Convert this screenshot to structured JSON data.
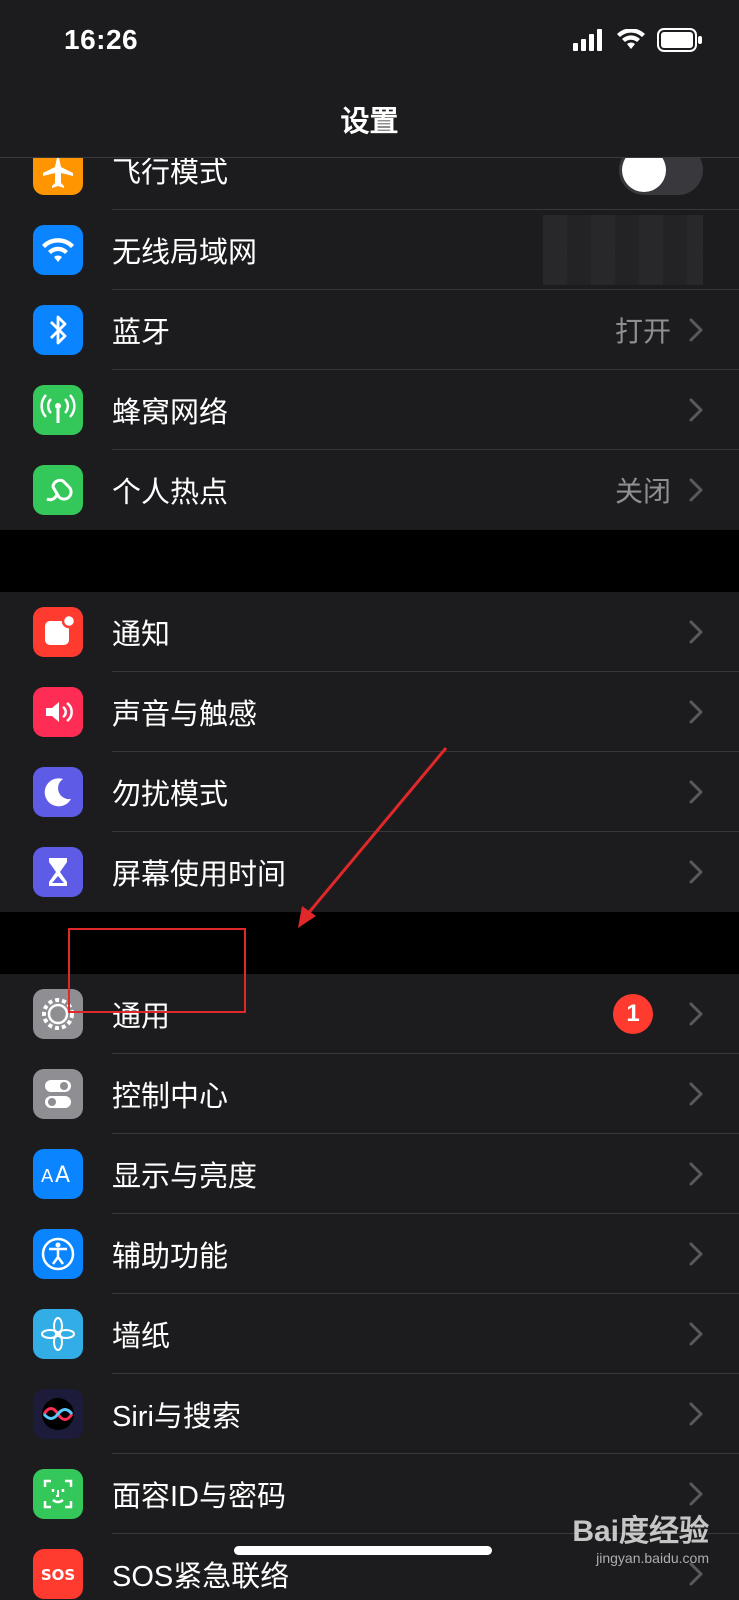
{
  "status_bar": {
    "time": "16:26"
  },
  "nav": {
    "title": "设置"
  },
  "groups": [
    [
      {
        "label": "飞行模式",
        "icon": "airplane-icon",
        "color": "#ff9500",
        "accessory": "toggle"
      },
      {
        "label": "无线局域网",
        "icon": "wifi-icon",
        "color": "#0a84ff",
        "accessory": "blurred"
      },
      {
        "label": "蓝牙",
        "icon": "bluetooth-icon",
        "color": "#0a84ff",
        "value": "打开"
      },
      {
        "label": "蜂窝网络",
        "icon": "antenna-icon",
        "color": "#34c759"
      },
      {
        "label": "个人热点",
        "icon": "hotspot-icon",
        "color": "#34c759",
        "value": "关闭"
      }
    ],
    [
      {
        "label": "通知",
        "icon": "notification-icon",
        "color": "#ff3b30"
      },
      {
        "label": "声音与触感",
        "icon": "speaker-icon",
        "color": "#ff2d55"
      },
      {
        "label": "勿扰模式",
        "icon": "moon-icon",
        "color": "#5e5ce6"
      },
      {
        "label": "屏幕使用时间",
        "icon": "hourglass-icon",
        "color": "#5e5ce6"
      }
    ],
    [
      {
        "label": "通用",
        "icon": "gear-icon",
        "color": "#8e8e93",
        "badge": "1"
      },
      {
        "label": "控制中心",
        "icon": "toggles-icon",
        "color": "#8e8e93"
      },
      {
        "label": "显示与亮度",
        "icon": "text-size-icon",
        "color": "#0a84ff"
      },
      {
        "label": "辅助功能",
        "icon": "accessibility-icon",
        "color": "#0a84ff"
      },
      {
        "label": "墙纸",
        "icon": "flower-icon",
        "color": "#32ade6"
      },
      {
        "label": "Siri与搜索",
        "icon": "siri-icon",
        "color": "#1c1c3a"
      },
      {
        "label": "面容ID与密码",
        "icon": "faceid-icon",
        "color": "#34c759"
      },
      {
        "label": "SOS紧急联络",
        "icon": "sos-icon",
        "color": "#ff3b30"
      }
    ]
  ],
  "watermark": {
    "logo": "Bai度经验",
    "url": "jingyan.baidu.com"
  }
}
